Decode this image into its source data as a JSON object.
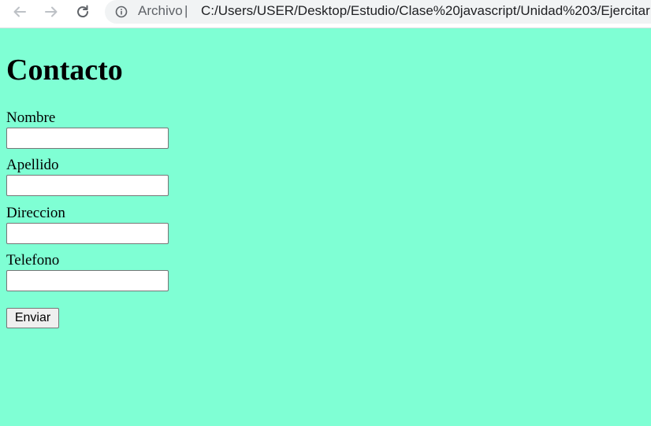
{
  "browser": {
    "scheme_label": "Archivo",
    "separator": "|",
    "url": "C:/Users/USER/Desktop/Estudio/Clase%20javascript/Unidad%203/Ejercitar"
  },
  "page": {
    "title": "Contacto",
    "background_color": "#7fffd4",
    "fields": [
      {
        "label": "Nombre",
        "value": ""
      },
      {
        "label": "Apellido",
        "value": ""
      },
      {
        "label": "Direccion",
        "value": ""
      },
      {
        "label": "Telefono",
        "value": ""
      }
    ],
    "submit_label": "Enviar"
  },
  "icons": {
    "back": "arrow-left-icon",
    "forward": "arrow-right-icon",
    "reload": "reload-icon",
    "info": "info-icon"
  }
}
